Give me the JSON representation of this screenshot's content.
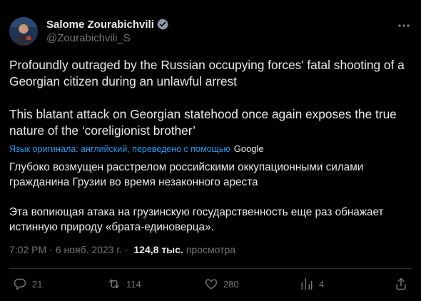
{
  "author": {
    "name": "Salome Zourabichvili",
    "handle": "@Zourabichvili_S"
  },
  "tweet": {
    "paragraph1": "Profoundly outraged by the Russian occupying forces' fatal shooting of a Georgian citizen during an unlawful arrest",
    "paragraph2": "This blatant attack on Georgian statehood once again exposes the true nature of the ‘coreligionist brother’"
  },
  "translation": {
    "notice": "Язык оригинала: английский, переведено с помощью",
    "provider": "Google",
    "paragraph1": "Глубоко возмущен расстрелом российскими оккупационными силами гражданина Грузии во время незаконного ареста",
    "paragraph2": "Эта вопиющая атака на грузинскую государственность еще раз обнажает истинную природу «брата-единоверца»."
  },
  "meta": {
    "time": "7:02 PM",
    "separator": "·",
    "date": "6 нояб. 2023 г.",
    "views_count": "124,8 тыс.",
    "views_label": "просмотра"
  },
  "actions": {
    "replies": "21",
    "retweets": "114",
    "likes": "280",
    "bookmarks": "4"
  },
  "colors": {
    "background": "#000000",
    "text": "#e7e9ea",
    "secondary": "#71767b",
    "accent": "#1d9bf0"
  }
}
